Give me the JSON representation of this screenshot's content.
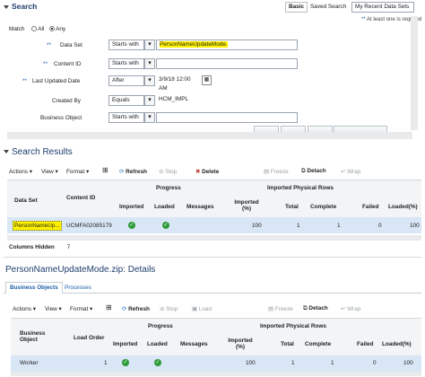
{
  "search": {
    "title": "Search",
    "tabs": [
      "Basic",
      "Saved Search"
    ],
    "saved_value": "My Recent Data Sets",
    "required_note": "At least one is required",
    "match_label": "Match",
    "match_all": "All",
    "match_any": "Any",
    "fields": [
      {
        "label": "Data Set",
        "operator": "Starts with",
        "value": "PersonNameUpdateMode.",
        "required": true
      },
      {
        "label": "Content ID",
        "operator": "Starts with",
        "value": "",
        "required": true
      },
      {
        "label": "Last Updated Date",
        "operator": "After",
        "value": "3/9/18 12:00 AM",
        "required": true
      },
      {
        "label": "Created By",
        "operator": "Equals",
        "value": "HCM_IMPL",
        "required": false
      },
      {
        "label": "Business Object",
        "operator": "Starts with",
        "value": "",
        "required": false
      }
    ]
  },
  "results": {
    "title": "Search Results",
    "menus": [
      "Actions",
      "View",
      "Format"
    ],
    "tools": [
      "Refresh",
      "Stop",
      "Delete",
      "Freeze",
      "Detach",
      "Wrap"
    ],
    "headers": {
      "dataset": "Data Set",
      "contentid": "Content ID",
      "progress": "Progress",
      "imported_rows": "Imported Physical Rows",
      "imported": "Imported",
      "loaded": "Loaded",
      "messages": "Messages",
      "imported_pct": "Imported (%)",
      "total": "Total",
      "complete": "Complete",
      "failed": "Failed",
      "loaded_pct": "Loaded(%)"
    },
    "row": {
      "dataset": "PersonNameUp...",
      "contentid": "UCMFA02085179",
      "imported_pct": "100",
      "total": "1",
      "complete": "1",
      "failed": "0",
      "loaded_pct": "100"
    },
    "columns_hidden_label": "Columns Hidden",
    "columns_hidden_value": "7"
  },
  "details": {
    "title": "PersonNameUpdateMode.zip: Details",
    "tabs": [
      "Business Objects",
      "Processes"
    ],
    "menus": [
      "Actions",
      "View",
      "Format"
    ],
    "tools": [
      "Refresh",
      "Stop",
      "Load",
      "Freeze",
      "Detach",
      "Wrap"
    ],
    "headers": {
      "bo": "Business Object",
      "load_order": "Load Order",
      "progress": "Progress",
      "imported_rows": "Imported Physical Rows",
      "imported": "Imported",
      "loaded": "Loaded",
      "messages": "Messages",
      "imported_pct": "Imported (%)",
      "total": "Total",
      "complete": "Complete",
      "failed": "Failed",
      "loaded_pct": "Loaded(%)"
    },
    "row": {
      "bo": "Worker",
      "load_order": "1",
      "imported_pct": "100",
      "total": "1",
      "complete": "1",
      "failed": "0",
      "loaded_pct": "100"
    }
  },
  "colors": {
    "highlight": "#fff200",
    "selected_row": "#d9e6f5",
    "header_text": "#1f3e6e",
    "check": "#2d9b3a"
  }
}
